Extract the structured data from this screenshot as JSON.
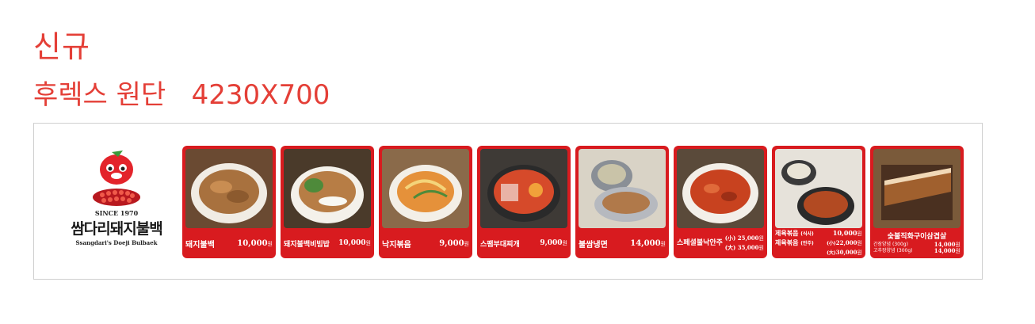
{
  "heading": "신규",
  "subheading": "후렉스 원단   4230X700",
  "logo": {
    "since": "SINCE 1970",
    "name": "쌈다리돼지불백",
    "english": "Ssangdari's Doeji Bulbaek"
  },
  "menu": [
    {
      "name": "돼지불백",
      "price": "10,000",
      "unit": "원"
    },
    {
      "name": "돼지불백비빔밥",
      "price": "10,000",
      "unit": "원"
    },
    {
      "name": "낙지볶음",
      "price": "9,000",
      "unit": "원"
    },
    {
      "name": "스팸부대찌개",
      "price": "9,000",
      "unit": "원"
    },
    {
      "name": "불쌈냉면",
      "price": "14,000",
      "unit": "원"
    },
    {
      "name": "스페셜불낙안주",
      "sizes": [
        {
          "size": "(小)",
          "price": "25,000",
          "unit": "원"
        },
        {
          "size": "(大)",
          "price": "35,000",
          "unit": "원"
        }
      ]
    },
    {
      "lines": [
        {
          "name": "제육볶음",
          "tag": "(식사)",
          "price": "10,000",
          "unit": "원"
        },
        {
          "name": "제육볶음",
          "tag": "(안주)",
          "size": "(小)",
          "price": "22,000",
          "unit": "원"
        },
        {
          "size": "(大)",
          "price": "30,000",
          "unit": "원"
        }
      ]
    },
    {
      "name": "숯불직화구이삼겹살",
      "lines": [
        {
          "label": "간장양념",
          "qty": "(300g)",
          "price": "14,000",
          "unit": "원"
        },
        {
          "label": "고추장양념",
          "qty": "(300g)",
          "price": "14,000",
          "unit": "원"
        }
      ]
    }
  ],
  "colors": {
    "accent": "#e43f37",
    "card": "#d81b1f"
  }
}
